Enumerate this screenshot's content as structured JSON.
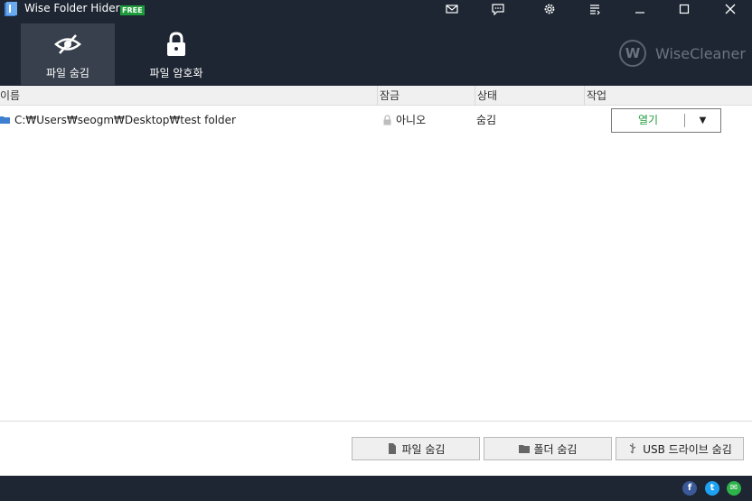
{
  "titlebar": {
    "title": "Wise Folder Hider",
    "badge": "FREE",
    "buttons": [
      "mail-icon",
      "feedback-icon",
      "settings-icon",
      "menu-icon",
      "minimize-icon",
      "maximize-icon",
      "close-icon"
    ]
  },
  "toolbar": {
    "tabs": [
      {
        "label": "파일 숨김",
        "icon": "eye-slash-icon",
        "active": true
      },
      {
        "label": "파일 암호화",
        "icon": "lock-icon",
        "active": false
      }
    ],
    "brand": {
      "logo_letter": "W",
      "text": "WiseCleaner"
    }
  },
  "table": {
    "columns": [
      "이름",
      "잠금",
      "상태",
      "작업"
    ],
    "rows": [
      {
        "name": "C:₩Users₩seogm₩Desktop₩test folder",
        "lock": "아니오",
        "status": "숨김",
        "action": "열기"
      }
    ]
  },
  "bottom": {
    "buttons": [
      {
        "label": "파일 숨김",
        "icon": "file-icon"
      },
      {
        "label": "폴더 숨김",
        "icon": "folder-icon"
      },
      {
        "label": "USB 드라이브 숨김",
        "icon": "usb-icon"
      }
    ]
  },
  "footer": {
    "social": [
      {
        "name": "facebook-icon",
        "glyph": "f",
        "color": "#3b5998"
      },
      {
        "name": "twitter-icon",
        "glyph": "t",
        "color": "#1da1f2"
      },
      {
        "name": "email-share-icon",
        "glyph": "✉",
        "color": "#2eb24a"
      }
    ]
  },
  "colors": {
    "dark": "#1e2633",
    "accent": "#1e9c3c"
  }
}
